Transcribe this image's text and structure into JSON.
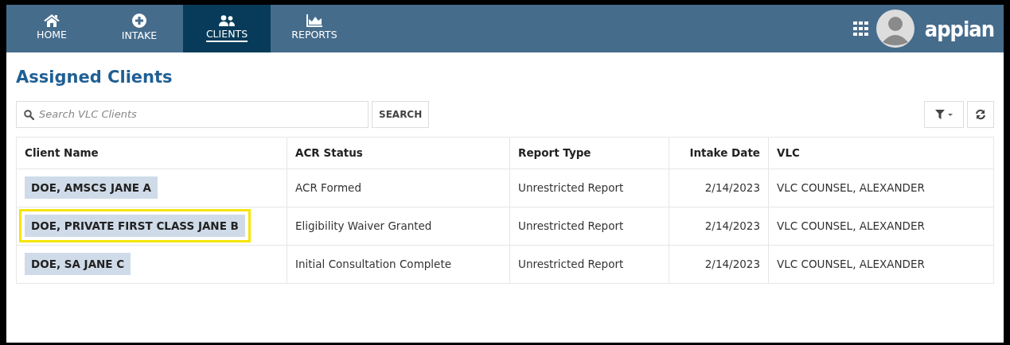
{
  "nav": {
    "tabs": [
      {
        "label": "HOME",
        "selected": false
      },
      {
        "label": "INTAKE",
        "selected": false
      },
      {
        "label": "CLIENTS",
        "selected": true
      },
      {
        "label": "REPORTS",
        "selected": false
      }
    ],
    "logo": "appian"
  },
  "page_title": "Assigned Clients",
  "search": {
    "placeholder": "Search VLC Clients",
    "button": "SEARCH"
  },
  "table": {
    "columns": [
      "Client Name",
      "ACR Status",
      "Report Type",
      "Intake Date",
      "VLC"
    ],
    "rows": [
      {
        "highlighted": false,
        "cells": [
          "DOE, AMSCS JANE A",
          "ACR Formed",
          "Unrestricted Report",
          "2/14/2023",
          "VLC COUNSEL, ALEXANDER"
        ]
      },
      {
        "highlighted": true,
        "cells": [
          "DOE, PRIVATE FIRST CLASS JANE B",
          "Eligibility Waiver Granted",
          "Unrestricted Report",
          "2/14/2023",
          "VLC COUNSEL, ALEXANDER"
        ]
      },
      {
        "highlighted": false,
        "cells": [
          "DOE, SA JANE C",
          "Initial Consultation Complete",
          "Unrestricted Report",
          "2/14/2023",
          "VLC COUNSEL, ALEXANDER"
        ]
      }
    ]
  }
}
